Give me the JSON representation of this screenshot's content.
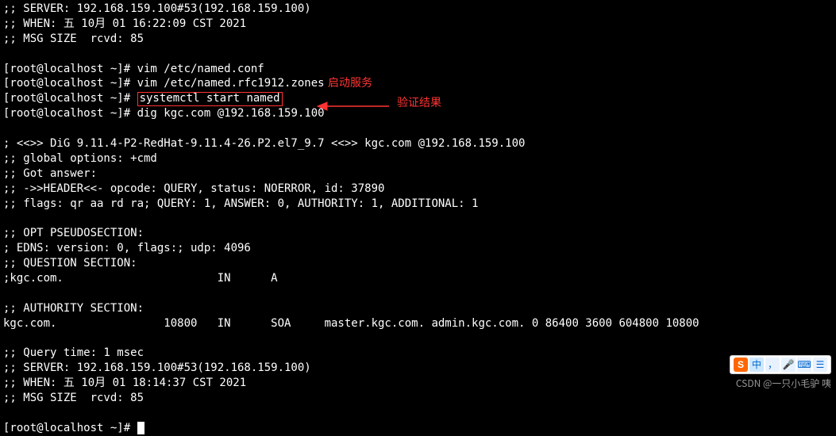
{
  "terminal": {
    "block1": [
      ";; SERVER: 192.168.159.100#53(192.168.159.100)",
      ";; WHEN: 五 10月 01 16:22:09 CST 2021",
      ";; MSG SIZE  rcvd: 85",
      ""
    ],
    "prompt": "[root@localhost ~]# ",
    "cmd_vim1": "vim /etc/named.conf",
    "cmd_vim2": "vim /etc/named.rfc1912.zones",
    "cmd_start": "systemctl start named",
    "cmd_dig": "dig kgc.com @192.168.159.100",
    "dig_output": [
      "",
      "; <<>> DiG 9.11.4-P2-RedHat-9.11.4-26.P2.el7_9.7 <<>> kgc.com @192.168.159.100",
      ";; global options: +cmd",
      ";; Got answer:",
      ";; ->>HEADER<<- opcode: QUERY, status: NOERROR, id: 37890",
      ";; flags: qr aa rd ra; QUERY: 1, ANSWER: 0, AUTHORITY: 1, ADDITIONAL: 1",
      "",
      ";; OPT PSEUDOSECTION:",
      "; EDNS: version: 0, flags:; udp: 4096",
      ";; QUESTION SECTION:",
      ";kgc.com.                       IN      A",
      "",
      ";; AUTHORITY SECTION:",
      "kgc.com.                10800   IN      SOA     master.kgc.com. admin.kgc.com. 0 86400 3600 604800 10800",
      "",
      ";; Query time: 1 msec",
      ";; SERVER: 192.168.159.100#53(192.168.159.100)",
      ";; WHEN: 五 10月 01 18:14:37 CST 2021",
      ";; MSG SIZE  rcvd: 85",
      ""
    ]
  },
  "annotations": {
    "start_label": "启动服务",
    "verify_label": "验证结果"
  },
  "watermark": "CSDN @一只小毛驴 咦",
  "ime": {
    "logo": "S",
    "mode": "中",
    "punct": "，",
    "mic": "🎤",
    "kb": "⌨",
    "menu": "☰"
  }
}
